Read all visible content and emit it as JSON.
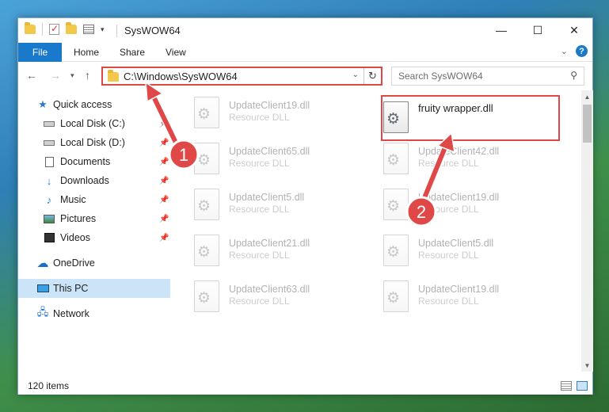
{
  "window": {
    "title": "SysWOW64",
    "controls": {
      "minimize": "—",
      "maximize": "☐",
      "close": "✕"
    }
  },
  "ribbon": {
    "file_tab": "File",
    "tabs": [
      "Home",
      "Share",
      "View"
    ]
  },
  "navigation": {
    "address": "C:\\Windows\\SysWOW64",
    "search_placeholder": "Search SysWOW64"
  },
  "sidebar": {
    "items": [
      {
        "label": "Quick access",
        "icon": "star-icon"
      },
      {
        "label": "Local Disk (C:)",
        "icon": "drive-icon",
        "pinned": true
      },
      {
        "label": "Local Disk (D:)",
        "icon": "drive-icon",
        "pinned": true
      },
      {
        "label": "Documents",
        "icon": "documents-icon",
        "pinned": true
      },
      {
        "label": "Downloads",
        "icon": "downloads-icon",
        "pinned": true
      },
      {
        "label": "Music",
        "icon": "music-icon",
        "pinned": true
      },
      {
        "label": "Pictures",
        "icon": "pictures-icon",
        "pinned": true
      },
      {
        "label": "Videos",
        "icon": "videos-icon",
        "pinned": true
      },
      {
        "label": "OneDrive",
        "icon": "onedrive-icon"
      },
      {
        "label": "This PC",
        "icon": "this-pc-icon",
        "selected": true
      },
      {
        "label": "Network",
        "icon": "network-icon"
      }
    ]
  },
  "files": {
    "left_column": [
      {
        "name": "UpdateClient19.dll",
        "type": "Resource DLL"
      },
      {
        "name": "UpdateClient65.dll",
        "type": "Resource DLL"
      },
      {
        "name": "UpdateClient5.dll",
        "type": "Resource DLL"
      },
      {
        "name": "UpdateClient21.dll",
        "type": "Resource DLL"
      },
      {
        "name": "UpdateClient63.dll",
        "type": "Resource DLL"
      }
    ],
    "right_column": [
      {
        "name": "fruity wrapper.dll",
        "type": "",
        "highlighted": true
      },
      {
        "name": "UpdateClient42.dll",
        "type": "Resource DLL"
      },
      {
        "name": "UpdateClient19.dll",
        "type": "Resource DLL"
      },
      {
        "name": "UpdateClient5.dll",
        "type": "Resource DLL"
      },
      {
        "name": "UpdateClient19.dll",
        "type": "Resource DLL"
      }
    ]
  },
  "status": {
    "item_count": "120 items"
  },
  "annotations": {
    "step1": "1",
    "step2": "2"
  },
  "colors": {
    "accent": "#1979ca",
    "highlight_red": "#e04848",
    "selected_bg": "#cce4f7"
  }
}
